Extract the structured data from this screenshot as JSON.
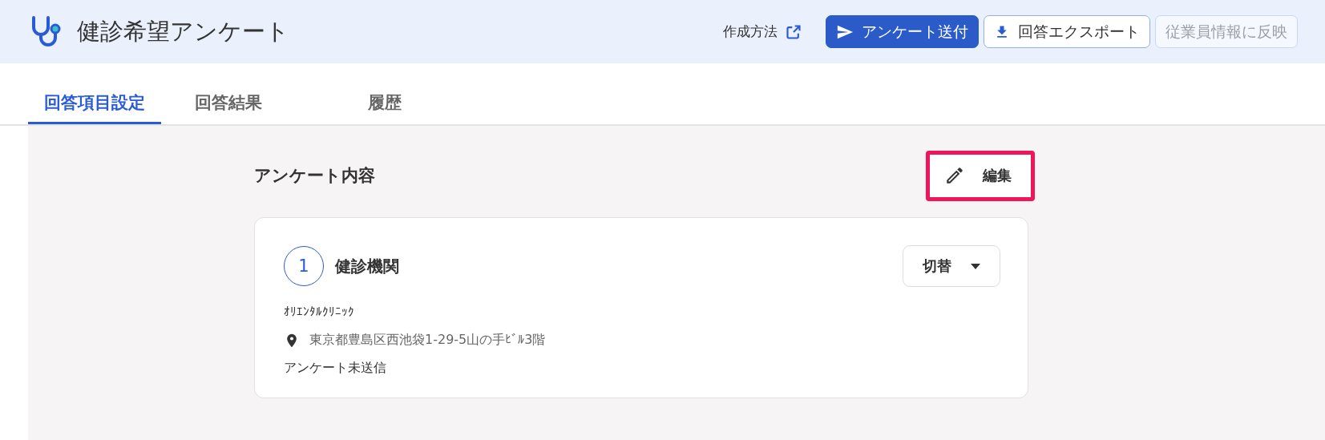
{
  "header": {
    "title": "健診希望アンケート",
    "help_link": "作成方法",
    "buttons": [
      {
        "kind": "primary",
        "label": "アンケート送付",
        "disabled": false
      },
      {
        "kind": "outline",
        "label": "回答エクスポート",
        "disabled": false
      },
      {
        "kind": "outline",
        "label": "従業員情報に反映",
        "disabled": true
      }
    ]
  },
  "tabs": [
    {
      "label": "回答項目設定",
      "selected": true
    },
    {
      "label": "回答結果",
      "selected": false
    },
    {
      "label": "履歴",
      "selected": false
    }
  ],
  "section": {
    "title": "アンケート内容",
    "edit_button": {
      "label": "編集",
      "highlighted": true
    }
  },
  "items": [
    {
      "number": "1",
      "title": "健診機関",
      "switch_label": "切替",
      "name": "ｵﾘｴﾝﾀﾙｸﾘﾆｯｸ",
      "address": "東京都豊島区西池袋1-29-5山の手ﾋﾞﾙ3階",
      "status": "アンケート未送信"
    }
  ]
}
